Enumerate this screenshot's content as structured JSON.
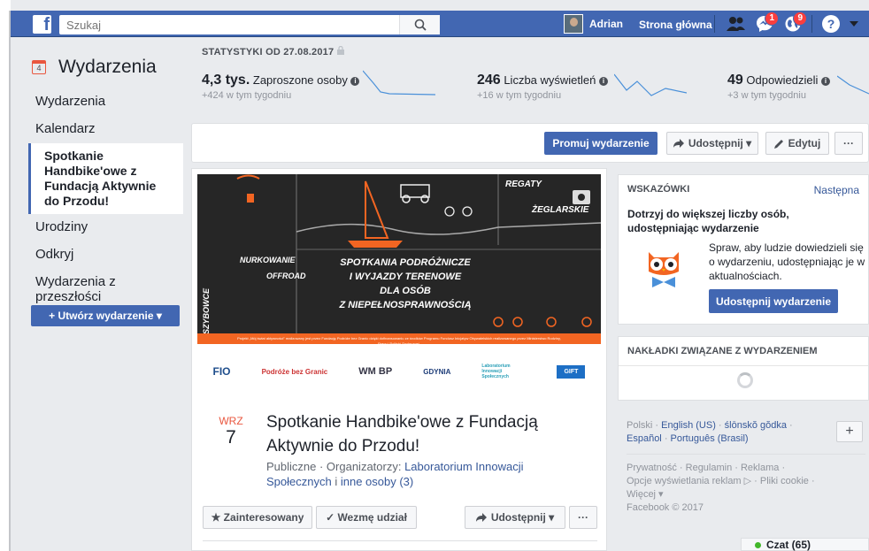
{
  "topbar": {
    "search_placeholder": "Szukaj",
    "user_name": "Adrian",
    "home": "Strona główna",
    "messages_badge": "1",
    "notifications_badge": "9",
    "help": "?"
  },
  "sidebar": {
    "title": "Wydarzenia",
    "items": [
      {
        "label": "Wydarzenia"
      },
      {
        "label": "Kalendarz"
      },
      {
        "label": "Spotkanie Handbike'owe z Fundacją Aktywnie do Przodu!"
      },
      {
        "label": "Urodziny"
      },
      {
        "label": "Odkryj"
      },
      {
        "label": "Wydarzenia z przeszłości"
      }
    ],
    "create_label": "+ Utwórz wydarzenie ▾"
  },
  "stats": {
    "title": "STATYSTYKI OD 27.08.2017",
    "invited": {
      "value": "4,3 tys.",
      "label": "Zaproszone osoby",
      "sub": "+424 w tym tygodniu"
    },
    "views": {
      "value": "246",
      "label": "Liczba wyświetleń",
      "sub": "+16 w tym tygodniu"
    },
    "responses": {
      "value": "49",
      "label": "Odpowiedzieli",
      "sub": "+3 w tym tygodniu"
    }
  },
  "actions": {
    "promote": "Promuj wydarzenie",
    "share": "Udostępnij ▾",
    "edit": "Edytuj",
    "more": "···"
  },
  "cover": {
    "label_regaty": "REGATY",
    "label_zeglarskie": "ŻEGLARSKIE",
    "label_nurkowanie": "NURKOWANIE",
    "label_offroad": "OFFROAD",
    "label_szybowce": "SZYBOWCE",
    "headline": [
      "SPOTKANIA PODRÓŻNICZE",
      "I WYJAZDY TERENOWE",
      "DLA OSÓB",
      "Z NIEPEŁNOSPRAWNOŚCIĄ"
    ],
    "strip_text": "Projekt „Mój świat aktywności” realizowany jest przez Fundację Podróże bez Granic dzięki dofinansowaniu ze środków Programu Fundusz Inicjatyw Obywatelskich realizowanego przez Ministerstwo Rodziny, Pracy i Polityki Społecznej.",
    "logos": [
      "FIO",
      "Podróże bez Granic",
      "WM BP",
      "GDYNIA",
      "Laboratorium Innowacji Społecznych",
      "GIFT"
    ]
  },
  "event": {
    "month": "WRZ",
    "day": "7",
    "title": "Spotkanie Handbike'owe z Fundacją Aktywnie do Przodu!",
    "meta_prefix": "Publiczne · Organizatorzy: ",
    "organizer": "Laboratorium Innowacji Społecznych",
    "meta_mid": " i ",
    "others": "inne osoby (3)",
    "interested": "★ Zainteresowany",
    "going": "✓ Wezmę udział",
    "share": "Udostępnij ▾",
    "more": "···"
  },
  "tips": {
    "header": "WSKAZÓWKI",
    "next": "Następna",
    "title": "Dotrzyj do większej liczby osób, udostępniając wydarzenie",
    "text": "Spraw, aby ludzie dowiedzieli się o wydarzeniu, udostępniając je w aktualnościach.",
    "button": "Udostępnij wydarzenie"
  },
  "overlays": {
    "header": "NAKŁADKI ZWIĄZANE Z WYDARZENIEM"
  },
  "footer": {
    "lang_current": "Polski",
    "langs": [
      "English (US)",
      "ślōnskŏ gŏdka",
      "Español",
      "Português (Brasil)"
    ],
    "links1": "Prywatność · Regulamin · Reklama ·",
    "links2": "Opcje wyświetlania reklam ▷ · Pliki cookie ·",
    "links3": "Więcej ▾",
    "copyright": "Facebook © 2017",
    "add": "+"
  },
  "chat": {
    "label": "Czat (65)"
  },
  "colors": {
    "brand": "#4267b2",
    "accent_orange": "#f26522",
    "date_red": "#e9573f"
  }
}
